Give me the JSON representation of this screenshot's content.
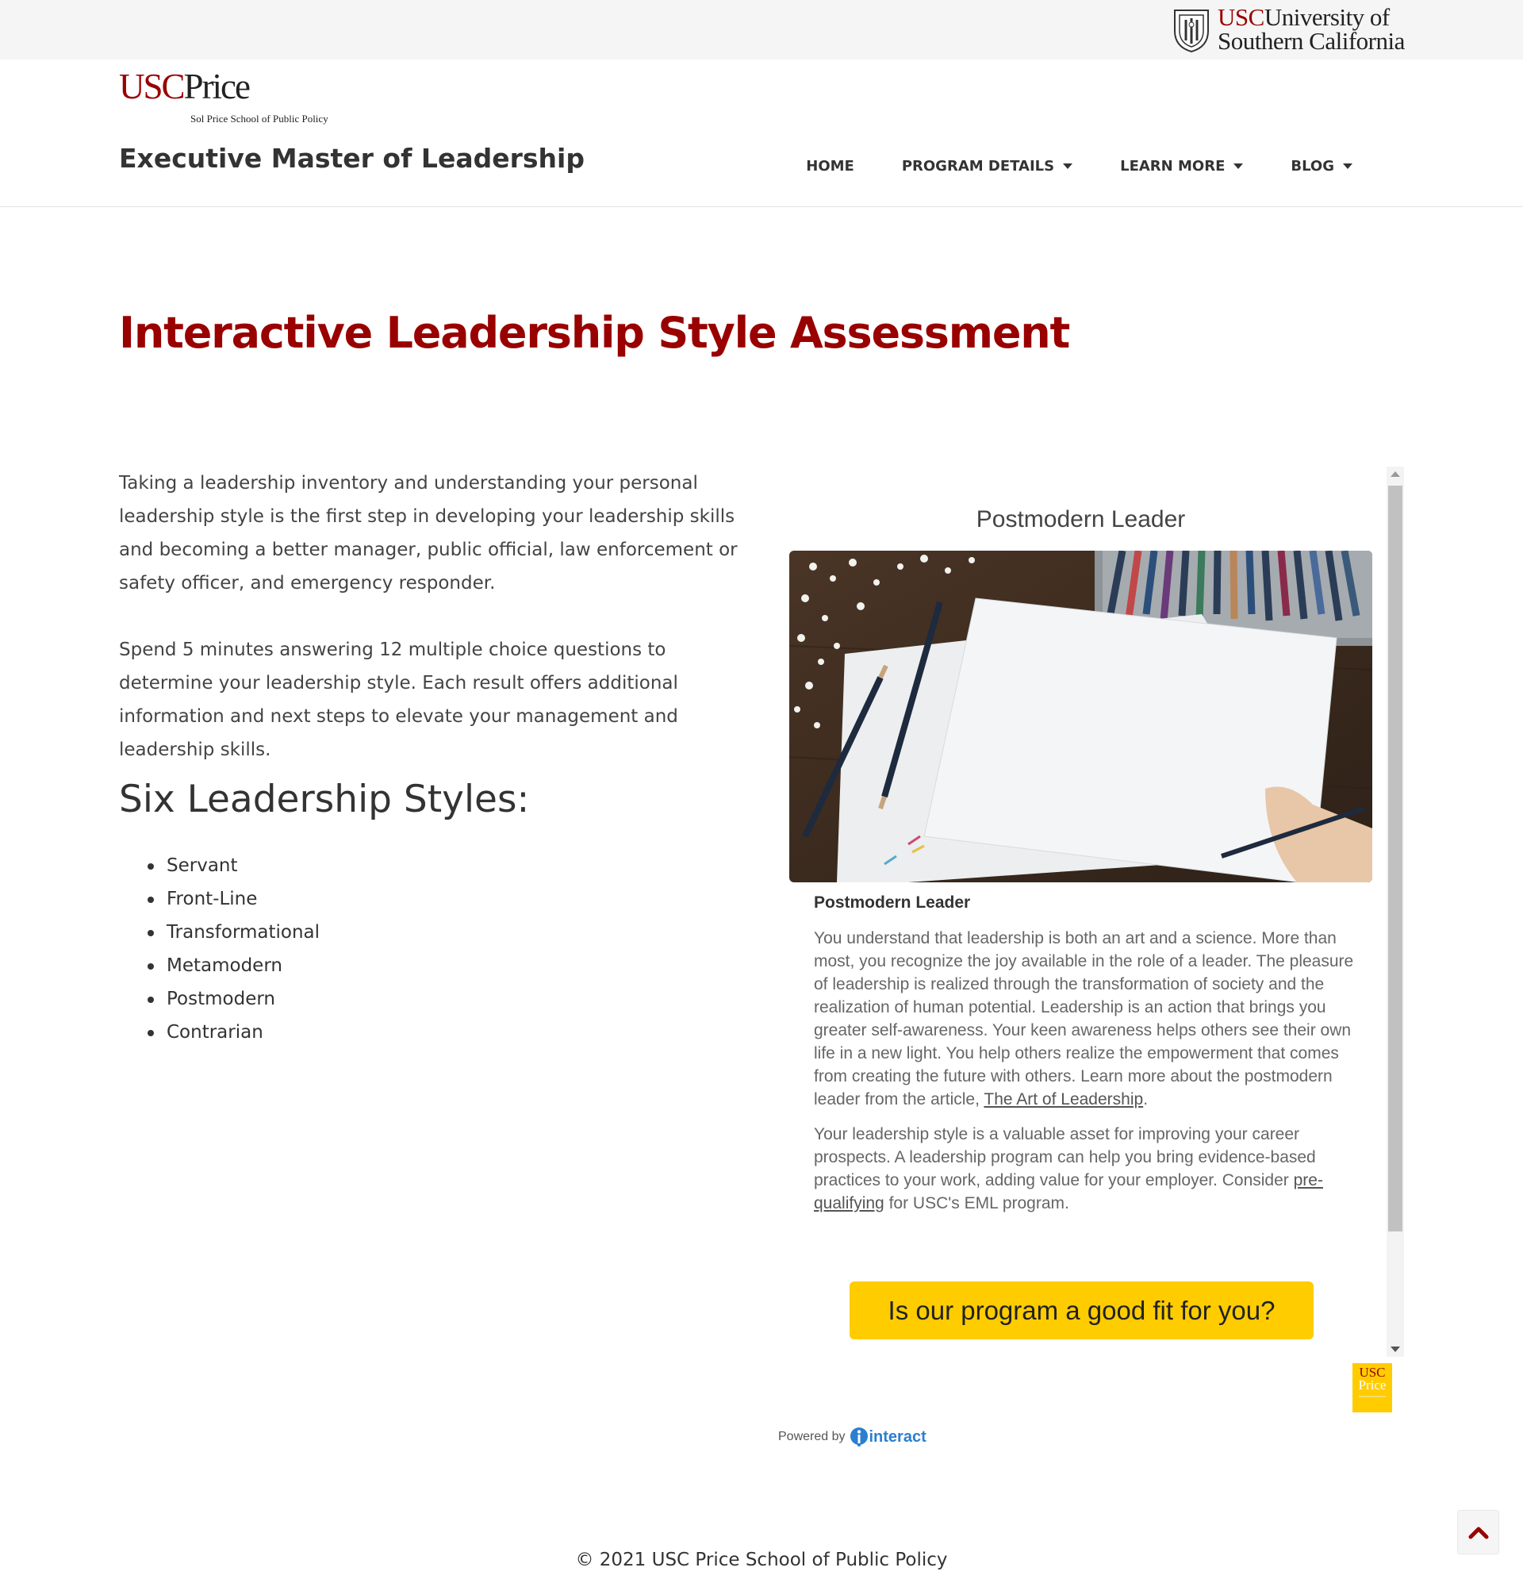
{
  "topbar": {
    "usc_short": "USC",
    "usc_line1": "University of",
    "usc_line2": "Southern California"
  },
  "header": {
    "logo_usc": "USC",
    "logo_price": "Price",
    "logo_sub": "Sol Price School of Public Policy",
    "site_title": "Executive Master of Leadership",
    "nav": [
      {
        "label": "HOME"
      },
      {
        "label": "PROGRAM DETAILS"
      },
      {
        "label": "LEARN MORE"
      },
      {
        "label": "BLOG"
      }
    ]
  },
  "page": {
    "heading": "Interactive Leadership Style Assessment",
    "intro_p1": "Taking a leadership inventory and understanding your personal leadership style is the first step in developing your leadership skills and becoming a better manager, public official, law enforcement or safety officer, and emergency responder.",
    "intro_p2": "Spend 5 minutes answering 12 multiple choice questions to determine your leadership style. Each result offers additional information and next steps to elevate your management and leadership skills.",
    "styles_heading": "Six Leadership Styles:",
    "styles": [
      "Servant",
      "Front-Line",
      "Transformational",
      "Metamodern",
      "Postmodern",
      "Contrarian"
    ]
  },
  "quiz": {
    "title": "Postmodern Leader",
    "subtitle": "Postmodern Leader",
    "body_p1": "You understand that leadership is both an art and a science. More than most, you recognize the joy available in the role of a leader. The pleasure of leadership is realized through the transformation of society and the realization of human potential. Leadership is an action that brings you greater self-awareness. Your keen awareness helps others see their own life in a new light. You help others realize the empowerment that comes from creating the future with others. Learn more about the postmodern leader from the article, ",
    "body_p1_link": "The Art of Leadership",
    "body_p1_end": ".",
    "body_p2_a": "Your leadership style is a valuable asset for improving your career prospects. A leadership program can help you bring evidence-based practices to your work, adding value for your employer. Consider ",
    "body_p2_link": "pre-qualifying",
    "body_p2_b": " for USC's EML program.",
    "cta": "Is our program a good fit for you?",
    "badge_line1": "USC",
    "badge_line2": "Price",
    "powered_by": "Powered by",
    "interact": "interact"
  },
  "footer": {
    "copyright": "© 2021 USC Price School of Public Policy"
  },
  "colors": {
    "brand_red": "#990000",
    "cta_yellow": "#ffcc00",
    "interact_blue": "#2a7fd0"
  },
  "icons": [
    "usc-seal-icon",
    "caret-down-icon",
    "interact-logo-icon",
    "chevron-up-icon"
  ]
}
